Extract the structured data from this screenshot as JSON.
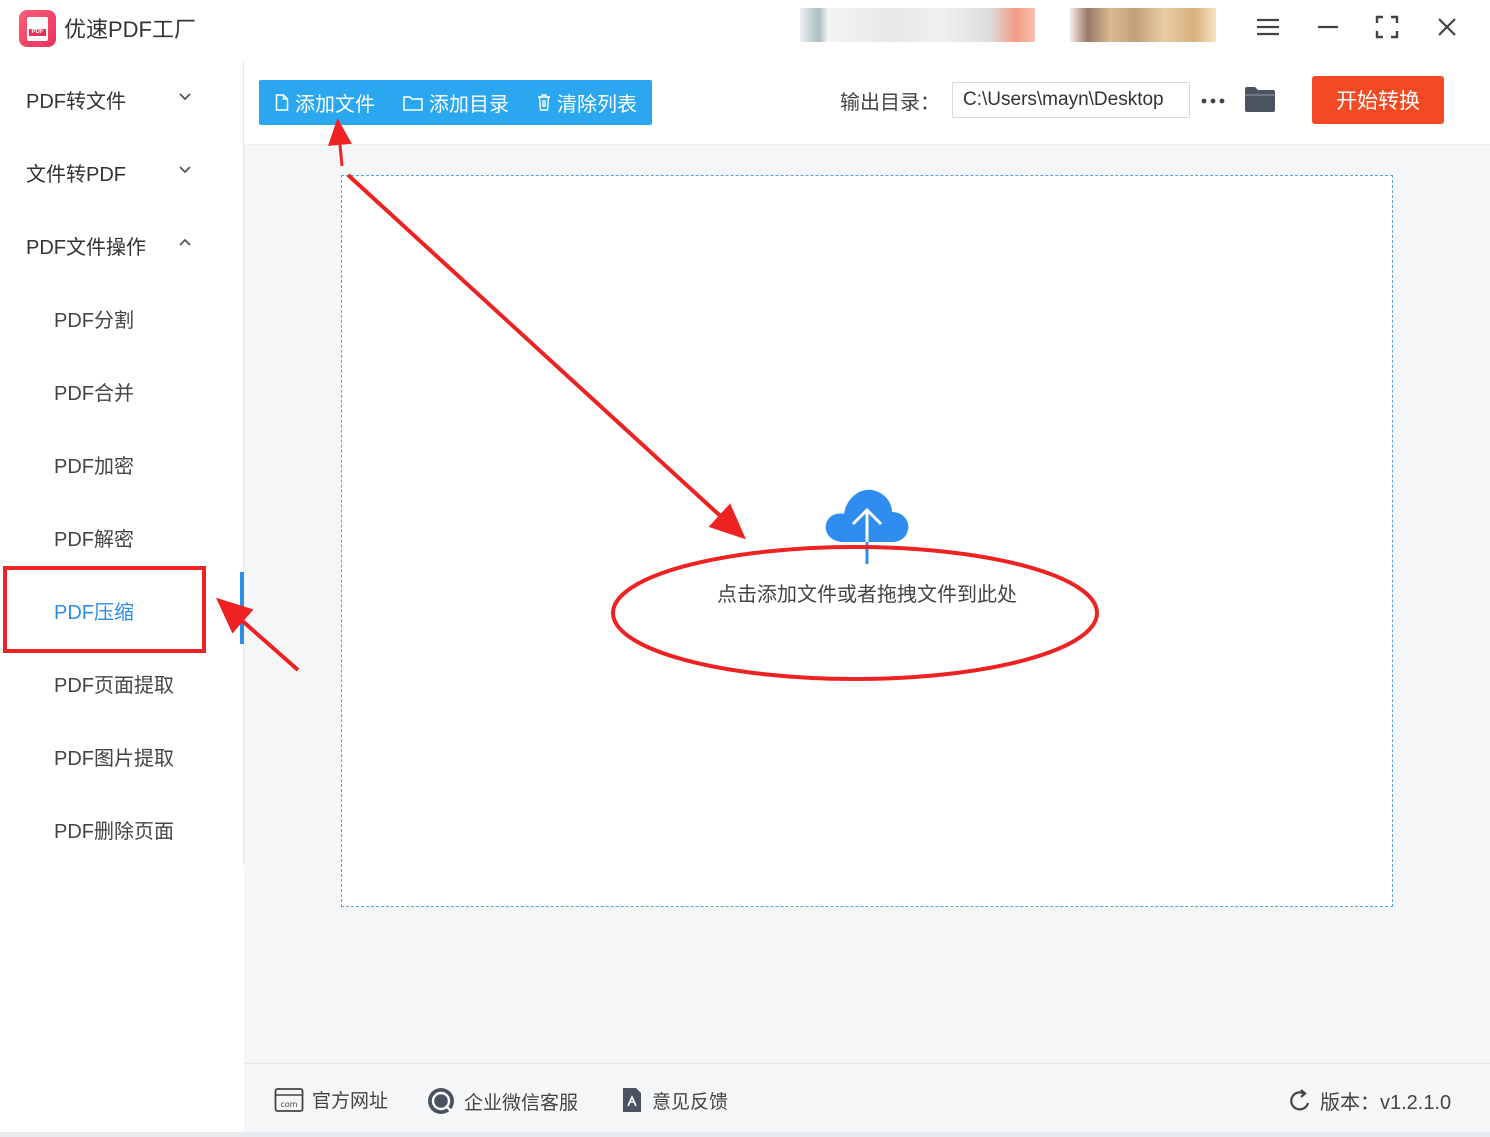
{
  "app": {
    "title": "优速PDF工厂",
    "logo_text": "PDF"
  },
  "sidebar": {
    "groups": [
      {
        "label": "PDF转文件",
        "expanded": false
      },
      {
        "label": "文件转PDF",
        "expanded": false
      },
      {
        "label": "PDF文件操作",
        "expanded": true
      }
    ],
    "items": [
      {
        "label": "PDF分割"
      },
      {
        "label": "PDF合并"
      },
      {
        "label": "PDF加密"
      },
      {
        "label": "PDF解密"
      },
      {
        "label": "PDF压缩",
        "active": true
      },
      {
        "label": "PDF页面提取"
      },
      {
        "label": "PDF图片提取"
      },
      {
        "label": "PDF删除页面"
      }
    ]
  },
  "toolbar": {
    "add_file": "添加文件",
    "add_dir": "添加目录",
    "clear_list": "清除列表",
    "output_label": "输出目录：",
    "output_path": "C:\\Users\\mayn\\Desktop",
    "start": "开始转换"
  },
  "dropzone": {
    "hint": "点击添加文件或者拖拽文件到此处"
  },
  "footer": {
    "website": "官方网址",
    "wechat": "企业微信客服",
    "feedback": "意见反馈",
    "version": "版本：v1.2.1.0"
  },
  "colors": {
    "accent": "#2aa7ee",
    "active_text": "#2a8de8",
    "start_button": "#f44a23",
    "annotation": "#ee2222"
  }
}
